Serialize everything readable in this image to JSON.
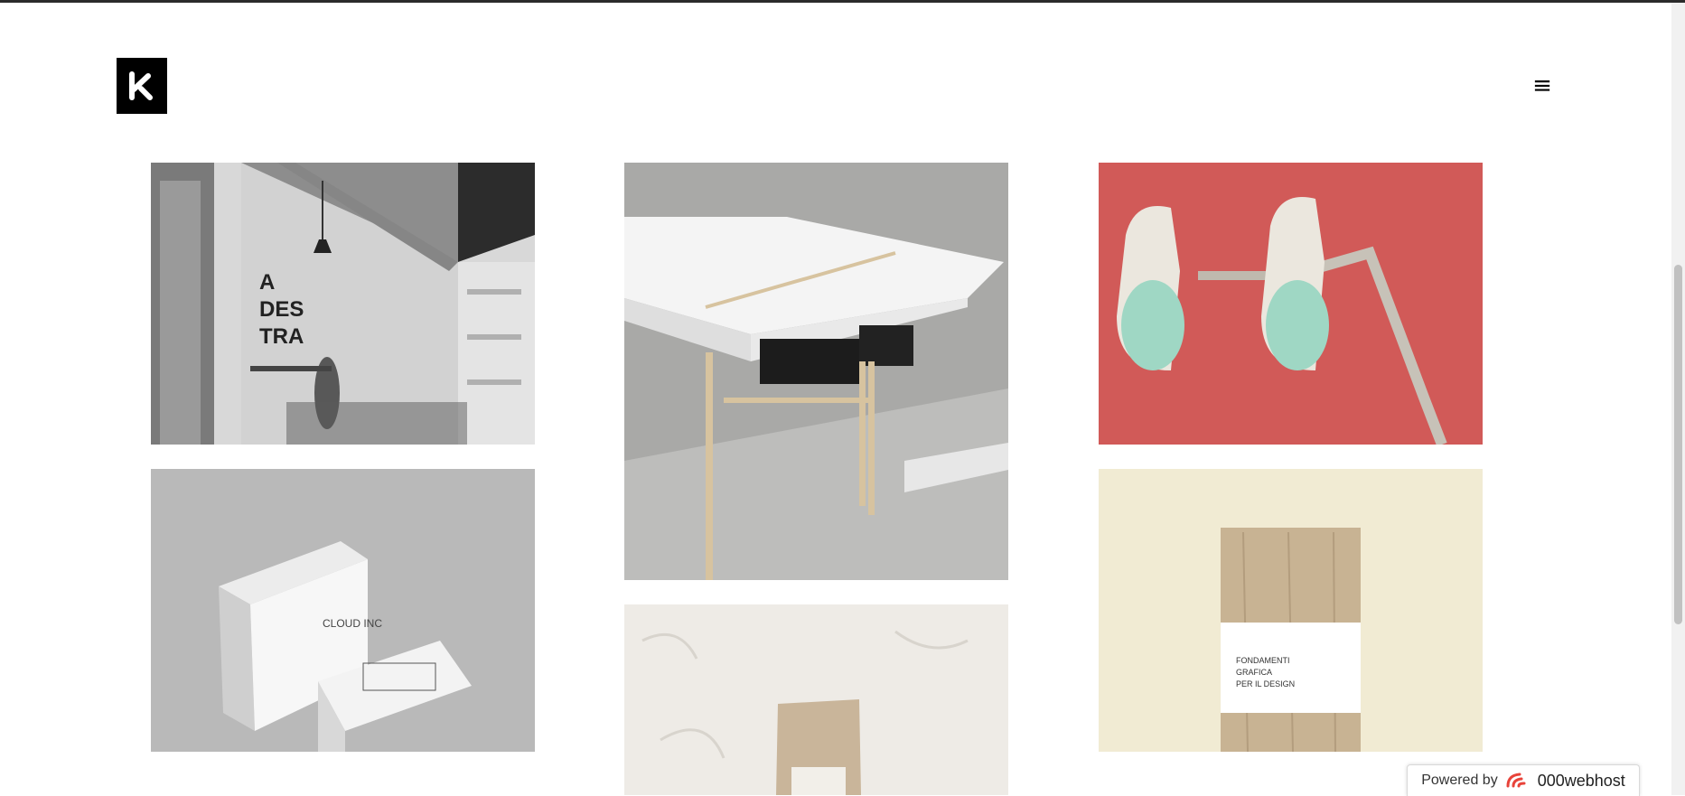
{
  "header": {
    "logo_icon": "k-monogram-icon",
    "menu_icon": "hamburger-menu-icon",
    "menu_glyph": "≡"
  },
  "portfolio": {
    "items": [
      {
        "subject": "adestra-studio-interior",
        "sign_text": [
          "A",
          "DES",
          "TRA"
        ]
      },
      {
        "subject": "white-desk-with-wooden-legs"
      },
      {
        "subject": "twin-white-lamps-on-red"
      },
      {
        "subject": "business-cards-mockup",
        "card_text": "CLOUD INC"
      },
      {
        "subject": "paper-bag-on-plaster-wall"
      },
      {
        "subject": "wooden-book-cover",
        "label_text": [
          "FONDAMENTI",
          "GRAFICA",
          "PER IL DESIGN"
        ]
      }
    ]
  },
  "footer": {
    "powered_label": "Powered by",
    "brand": "000webhost",
    "brand_icon": "000webhost-logo-icon"
  },
  "colors": {
    "background": "#ffffff",
    "logo_bg": "#000000",
    "lamp_red": "#d15a58",
    "brand_red": "#e8433a"
  }
}
